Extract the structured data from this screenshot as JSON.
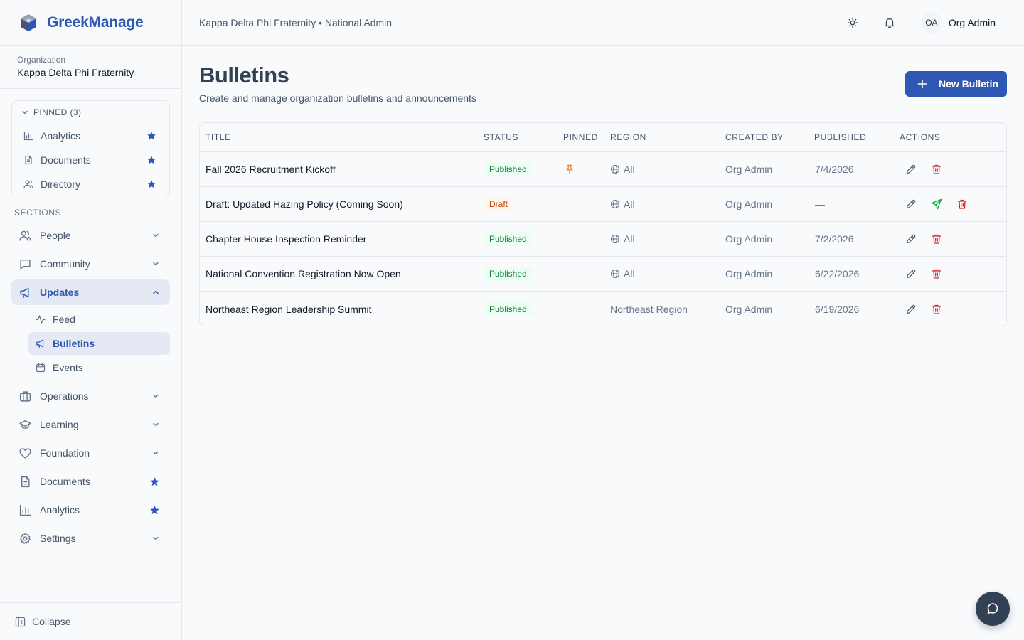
{
  "app": {
    "name": "GreekManage"
  },
  "organization": {
    "label": "Organization",
    "name": "Kappa Delta Phi Fraternity"
  },
  "pinned": {
    "header": "PINNED (3)",
    "items": [
      {
        "label": "Analytics",
        "icon": "bar-chart-icon"
      },
      {
        "label": "Documents",
        "icon": "document-icon"
      },
      {
        "label": "Directory",
        "icon": "users-icon"
      }
    ]
  },
  "sections": {
    "label": "SECTIONS",
    "items": [
      {
        "label": "People"
      },
      {
        "label": "Community"
      },
      {
        "label": "Updates"
      },
      {
        "label": "Operations"
      },
      {
        "label": "Learning"
      },
      {
        "label": "Foundation"
      },
      {
        "label": "Documents"
      },
      {
        "label": "Analytics"
      },
      {
        "label": "Settings"
      }
    ],
    "updates_sub": [
      {
        "label": "Feed"
      },
      {
        "label": "Bulletins"
      },
      {
        "label": "Events"
      }
    ]
  },
  "sidebar_footer": {
    "collapse_label": "Collapse"
  },
  "topbar": {
    "breadcrumb": "Kappa Delta Phi Fraternity • National Admin",
    "avatar_initials": "OA",
    "user_name": "Org Admin"
  },
  "page": {
    "title": "Bulletins",
    "subtitle": "Create and manage organization bulletins and announcements",
    "new_button_label": "New Bulletin"
  },
  "table": {
    "columns": [
      "TITLE",
      "STATUS",
      "PINNED",
      "REGION",
      "CREATED BY",
      "PUBLISHED",
      "ACTIONS"
    ],
    "rows": [
      {
        "title": "Fall 2026 Recruitment Kickoff",
        "status": "Published",
        "pinned": true,
        "region": "All",
        "created_by": "Org Admin",
        "published": "7/4/2026"
      },
      {
        "title": "Draft: Updated Hazing Policy (Coming Soon)",
        "status": "Draft",
        "pinned": false,
        "region": "All",
        "created_by": "Org Admin",
        "published": "—"
      },
      {
        "title": "Chapter House Inspection Reminder",
        "status": "Published",
        "pinned": false,
        "region": "All",
        "created_by": "Org Admin",
        "published": "7/2/2026"
      },
      {
        "title": "National Convention Registration Now Open",
        "status": "Published",
        "pinned": false,
        "region": "All",
        "created_by": "Org Admin",
        "published": "6/22/2026"
      },
      {
        "title": "Northeast Region Leadership Summit",
        "status": "Published",
        "pinned": false,
        "region": "Northeast Region",
        "created_by": "Org Admin",
        "published": "6/19/2026"
      }
    ]
  },
  "colors": {
    "accent": "#2f57b4",
    "published_bg": "#ecfdf3",
    "published_fg": "#15803d",
    "draft_bg": "#fff7ed",
    "draft_fg": "#c2410c",
    "delete": "#dc2626",
    "send": "#16a34a",
    "pin": "#ea7a1f"
  }
}
